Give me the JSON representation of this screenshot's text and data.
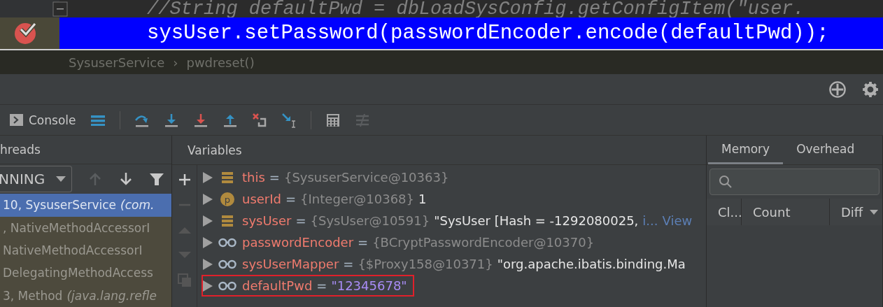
{
  "editor": {
    "lines": [
      {
        "text": "//String defaultPwd = dbLoadSysConfig.getConfigItem(\"user.",
        "kind": "comment",
        "current": false,
        "breakpoint": false
      },
      {
        "text": "sysUser.setPassword(passwordEncoder.encode(defaultPwd));",
        "kind": "code",
        "current": true,
        "breakpoint": true
      }
    ]
  },
  "breadcrumb": [
    "SysuserService",
    "›",
    "pwdreset()"
  ],
  "toolbar": {
    "console_label": "Console"
  },
  "threads": {
    "title": "hreads",
    "status": "NNING",
    "frames": [
      {
        "method": "10, SysuserService",
        "location": "(com.",
        "selected": true
      },
      {
        "method": ", NativeMethodAccessorI",
        "selected": false
      },
      {
        "method": "NativeMethodAccessorI",
        "selected": false
      },
      {
        "method": "DelegatingMethodAccess",
        "selected": false
      },
      {
        "method": "3, Method",
        "location": "(java.lang.refle",
        "selected": false
      }
    ]
  },
  "variables": {
    "title": "Variables",
    "rows": [
      {
        "kind": "field",
        "name": "this",
        "op": "=",
        "type": "{SysuserService@10363}",
        "highlighted": false
      },
      {
        "kind": "param",
        "badge": "p",
        "name": "userId",
        "op": "=",
        "type": "{Integer@10368}",
        "value": "1",
        "highlighted": false
      },
      {
        "kind": "field",
        "name": "sysUser",
        "op": "=",
        "type": "{SysUser@10591}",
        "value": "\"SysUser [Hash = -1292080025,",
        "more": "i...",
        "link": "View",
        "highlighted": false
      },
      {
        "kind": "watch",
        "name": "passwordEncoder",
        "op": "=",
        "type": "{BCryptPasswordEncoder@10370}",
        "highlighted": false
      },
      {
        "kind": "watch",
        "name": "sysUserMapper",
        "op": "=",
        "type": "{$Proxy158@10371}",
        "value": "\"org.apache.ibatis.binding.Ma",
        "highlighted": false
      },
      {
        "kind": "watch",
        "name": "defaultPwd",
        "op": "=",
        "string": "\"12345678\"",
        "highlighted": true
      }
    ]
  },
  "memory": {
    "tabs": [
      {
        "label": "Memory",
        "selected": true
      },
      {
        "label": "Overhead",
        "selected": false
      }
    ],
    "columns": [
      "Cl...",
      "Count",
      "Diff"
    ]
  }
}
